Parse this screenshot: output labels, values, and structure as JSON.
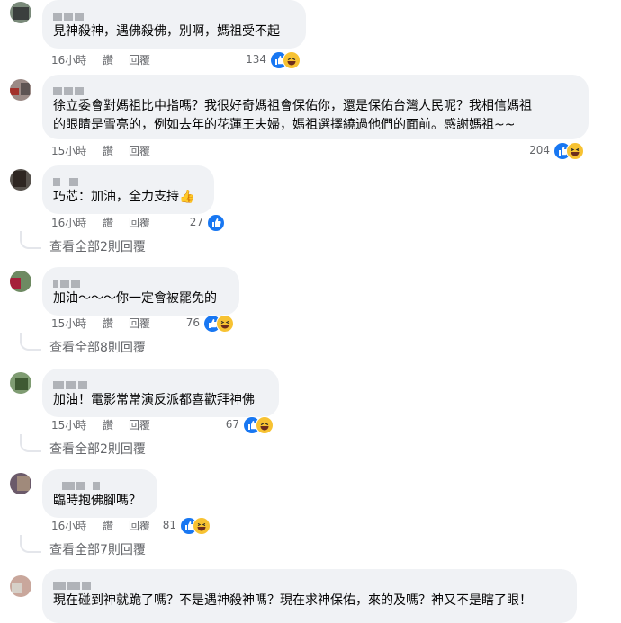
{
  "comments": [
    {
      "text": "見神殺神，遇佛殺佛，別啊，媽祖受不起",
      "time": "16小時",
      "like": "讚",
      "reply": "回覆",
      "count": "134",
      "reactions": [
        "like-icon",
        "haha-icon"
      ]
    },
    {
      "text": "徐立委會對媽祖比中指嗎？我很好奇媽祖會保佑你，還是保佑台灣人民呢？我相信媽祖\n的眼睛是雪亮的，例如去年的花蓮王夫婦，媽祖選擇繞過他們的面前。感謝媽祖~~",
      "time": "15小時",
      "like": "讚",
      "reply": "回覆",
      "count": "204",
      "reactions": [
        "like-icon",
        "haha-icon"
      ]
    },
    {
      "text": "巧芯：加油，全力支持👍",
      "time": "16小時",
      "like": "讚",
      "reply": "回覆",
      "count": "27",
      "reactions": [
        "like-icon"
      ],
      "view_replies": "查看全部2則回覆"
    },
    {
      "text": "加油～～～你一定會被罷免的",
      "time": "15小時",
      "like": "讚",
      "reply": "回覆",
      "count": "76",
      "reactions": [
        "like-icon",
        "haha-icon"
      ],
      "view_replies": "查看全部8則回覆"
    },
    {
      "text": "加油！電影常常演反派都喜歡拜神佛",
      "time": "15小時",
      "like": "讚",
      "reply": "回覆",
      "count": "67",
      "reactions": [
        "like-icon",
        "haha-icon"
      ],
      "view_replies": "查看全部2則回覆"
    },
    {
      "text": "臨時抱佛腳嗎？",
      "time": "16小時",
      "like": "讚",
      "reply": "回覆",
      "count": "81",
      "reactions": [
        "like-icon",
        "haha-icon"
      ],
      "view_replies": "查看全部7則回覆"
    },
    {
      "text": "現在碰到神就跪了嗎？不是遇神殺神嗎？現在求神保佑，來的及嗎？神又不是瞎了眼！"
    }
  ],
  "colors": {
    "bubble": "#f0f2f5",
    "meta_text": "#65676b",
    "like_blue": "#1877f2",
    "haha_yellow": "#f7c232"
  }
}
